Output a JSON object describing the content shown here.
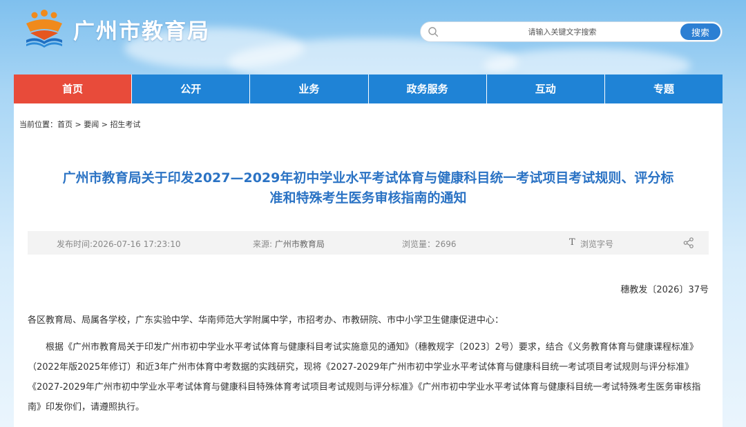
{
  "header": {
    "site_title": "广州市教育局",
    "search": {
      "placeholder": "请输入关键文字搜索",
      "button_label": "搜索"
    }
  },
  "nav": {
    "items": [
      {
        "label": "首页",
        "active": true
      },
      {
        "label": "公开",
        "active": false
      },
      {
        "label": "业务",
        "active": false
      },
      {
        "label": "政务服务",
        "active": false
      },
      {
        "label": "互动",
        "active": false
      },
      {
        "label": "专题",
        "active": false
      }
    ]
  },
  "breadcrumb": {
    "prefix": "当前位置：",
    "items": [
      "首页",
      "要闻",
      "招生考试"
    ],
    "separator": " > "
  },
  "article": {
    "title": "广州市教育局关于印发2027—2029年初中学业水平考试体育与健康科目统一考试项目考试规则、评分标准和特殊考生医务审核指南的通知",
    "meta": {
      "publish_time": "发布时间:2026-07-16 17:23:10",
      "source_label": "来源: ",
      "source_value": "广州市教育局",
      "views": "浏览量：2696",
      "font_size_label": "浏览字号"
    },
    "doc_number": "穗教发〔2026〕37号",
    "salutation": "各区教育局、局属各学校，广东实验中学、华南师范大学附属中学，市招考办、市教研院、市中小学卫生健康促进中心：",
    "body": "根据《广州市教育局关于印发广州市初中学业水平考试体育与健康科目考试实施意见的通知》（穗教规字〔2023〕2号）要求，结合《义务教育体育与健康课程标准》（2022年版2025年修订）和近3年广州市体育中考数据的实践研究，现将《2027-2029年广州市初中学业水平考试体育与健康科目统一考试项目考试规则与评分标准》《2027-2029年广州市初中学业水平考试体育与健康科目特殊体育考试项目考试规则与评分标准》《广州市初中学业水平考试体育与健康科目统一考试特殊考生医务审核指南》印发你们，请遵照执行。"
  },
  "icons": {
    "logo": "education-bureau-logo-icon",
    "search": "search-icon",
    "font": "font-size-icon",
    "share": "share-icon"
  },
  "colors": {
    "nav_blue": "#1f83d6",
    "nav_active_red": "#e84b3a",
    "title_blue": "#2b73c4",
    "search_button": "#2c7fd3"
  }
}
